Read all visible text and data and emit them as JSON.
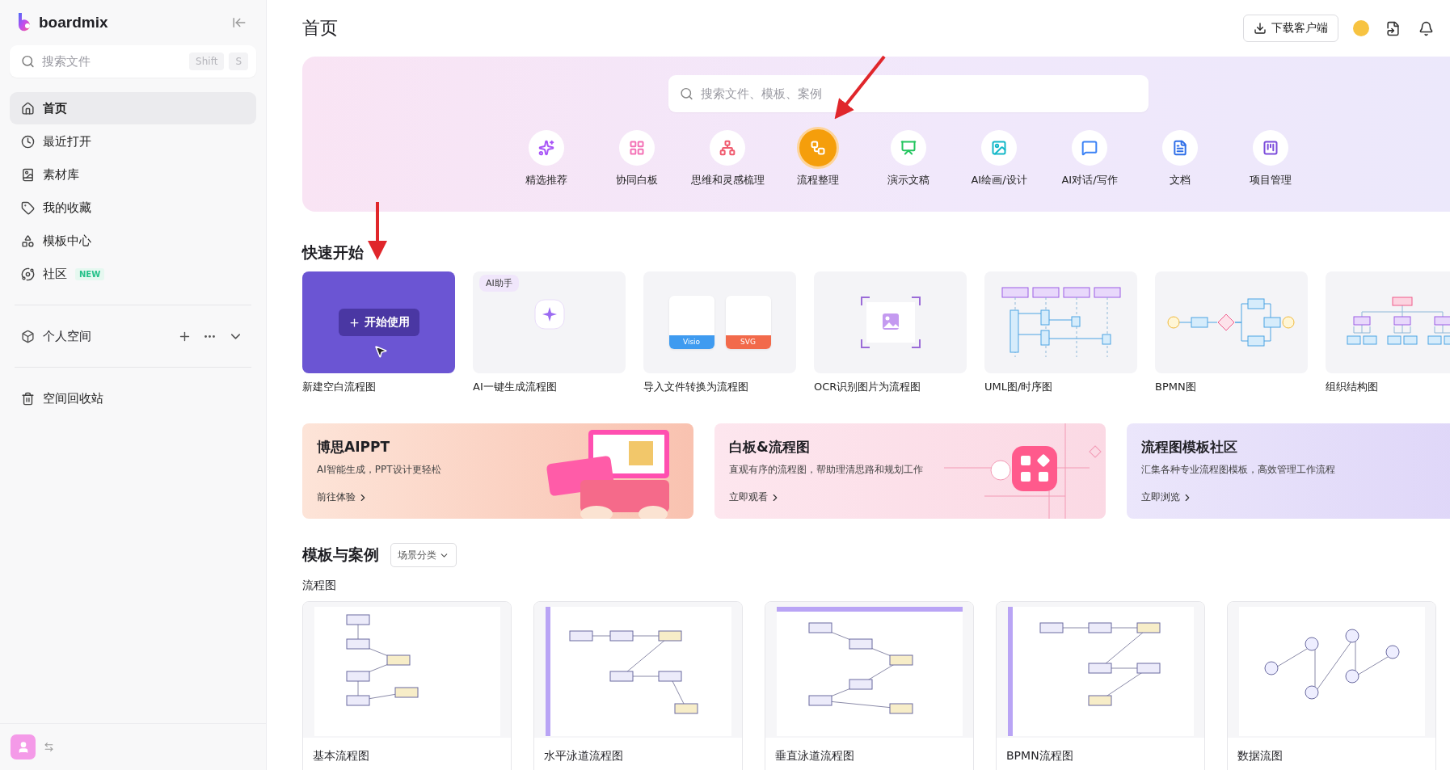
{
  "sidebar": {
    "brand": "boardmix",
    "search": {
      "placeholder": "搜索文件",
      "keys": [
        "Shift",
        "S"
      ]
    },
    "nav": [
      {
        "kind": "home",
        "label": "首页",
        "selected": true
      },
      {
        "kind": "clock",
        "label": "最近打开",
        "selected": false
      },
      {
        "kind": "library",
        "label": "素材库",
        "selected": false
      },
      {
        "kind": "tag",
        "label": "我的收藏",
        "selected": false
      },
      {
        "kind": "shapes",
        "label": "模板中心",
        "selected": false
      },
      {
        "kind": "planet",
        "label": "社区",
        "selected": false,
        "badge": "NEW"
      }
    ],
    "space": {
      "label": "个人空间",
      "expanded": false
    },
    "trash": {
      "label": "空间回收站"
    }
  },
  "header": {
    "title": "首页",
    "download": "下载客户端"
  },
  "hero": {
    "search_placeholder": "搜索文件、模板、案例",
    "categories": [
      {
        "kind": "sparkle",
        "label": "精选推荐",
        "color": "#a855f7",
        "selected": false
      },
      {
        "kind": "grid",
        "label": "协同白板",
        "color": "#f472b6",
        "selected": false
      },
      {
        "kind": "mindmap",
        "label": "思维和灵感梳理",
        "color": "#f05a6e",
        "selected": false
      },
      {
        "kind": "flow",
        "label": "流程整理",
        "color": "#f59e0b",
        "selected": true
      },
      {
        "kind": "slides",
        "label": "演示文稿",
        "color": "#22c55e",
        "selected": false
      },
      {
        "kind": "image",
        "label": "AI绘画/设计",
        "color": "#14b8c8",
        "selected": false
      },
      {
        "kind": "chat",
        "label": "AI对话/写作",
        "color": "#3b82f6",
        "selected": false
      },
      {
        "kind": "doc",
        "label": "文档",
        "color": "#2f6fe8",
        "selected": false
      },
      {
        "kind": "board",
        "label": "项目管理",
        "color": "#7c4ddb",
        "selected": false
      }
    ]
  },
  "quick_start": {
    "title": "快速开始",
    "cards": [
      {
        "kind": "blank",
        "label": "新建空白流程图",
        "button": "开始使用"
      },
      {
        "kind": "ai",
        "label": "AI一键生成流程图",
        "tag": "AI助手"
      },
      {
        "kind": "import",
        "label": "导入文件转换为流程图",
        "files": [
          "Visio",
          "SVG"
        ]
      },
      {
        "kind": "ocr",
        "label": "OCR识别图片为流程图"
      },
      {
        "kind": "uml",
        "label": "UML图/时序图"
      },
      {
        "kind": "bpmn",
        "label": "BPMN图"
      },
      {
        "kind": "org",
        "label": "组织结构图"
      }
    ]
  },
  "banners": [
    {
      "kind": "aippt",
      "title": "博思AIPPT",
      "subtitle": "AI智能生成，PPT设计更轻松",
      "link": "前往体验"
    },
    {
      "kind": "whiteboard",
      "title": "白板&流程图",
      "subtitle": "直观有序的流程图，帮助理清思路和规划工作",
      "link": "立即观看"
    },
    {
      "kind": "community",
      "title": "流程图模板社区",
      "subtitle": "汇集各种专业流程图模板，高效管理工作流程",
      "link": "立即浏览"
    }
  ],
  "templates": {
    "title": "模板与案例",
    "filter": "场景分类",
    "section": "流程图",
    "items": [
      {
        "kind": "basic",
        "label": "基本流程图"
      },
      {
        "kind": "hswim",
        "label": "水平泳道流程图"
      },
      {
        "kind": "vswim",
        "label": "垂直泳道流程图"
      },
      {
        "kind": "bpmn",
        "label": "BPMN流程图"
      },
      {
        "kind": "data",
        "label": "数据流图"
      }
    ]
  }
}
